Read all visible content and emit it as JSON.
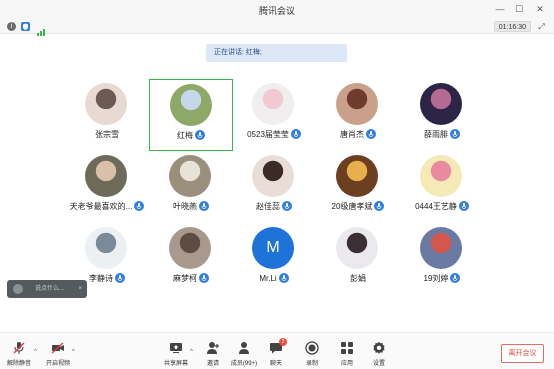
{
  "window": {
    "title": "腾讯会议",
    "controls": [
      "minimize-icon",
      "maximize-icon",
      "close-icon"
    ]
  },
  "status": {
    "timer": "01:16:30",
    "icons": [
      "info-icon",
      "shield-icon",
      "signal-icon"
    ]
  },
  "speaking": {
    "text": "正在讲话: 红梅;"
  },
  "participants": [
    {
      "name": "张宗雪",
      "mic": false,
      "avatar_color": "#e8d9d2",
      "avatar_accent": "#6e5a55"
    },
    {
      "name": "红梅",
      "mic": true,
      "avatar_color": "#8ea867",
      "avatar_accent": "#c7d7ea",
      "active": true
    },
    {
      "name": "0523届莹莹",
      "mic": true,
      "avatar_color": "#f1eef0",
      "avatar_accent": "#f0c9d2"
    },
    {
      "name": "唐肖杰",
      "mic": true,
      "avatar_color": "#caa08a",
      "avatar_accent": "#6e3b2c"
    },
    {
      "name": "薛雨腓",
      "mic": true,
      "avatar_color": "#2d2546",
      "avatar_accent": "#b56b8f"
    },
    {
      "name": "天老爷最喜欢的...",
      "mic": true,
      "avatar_color": "#6d6a5a",
      "avatar_accent": "#d9c1a8"
    },
    {
      "name": "叶晓燕",
      "mic": true,
      "avatar_color": "#9a8e7c",
      "avatar_accent": "#e9e2d6"
    },
    {
      "name": "赵佳蕊",
      "mic": true,
      "avatar_color": "#e8ddd7",
      "avatar_accent": "#3a2b25"
    },
    {
      "name": "20级唐孝斌",
      "mic": true,
      "avatar_color": "#6b3f1f",
      "avatar_accent": "#e7b04d"
    },
    {
      "name": "0444王艺静",
      "mic": true,
      "avatar_color": "#f5eab5",
      "avatar_accent": "#e98aa0"
    },
    {
      "name": "李静诗",
      "mic": true,
      "avatar_color": "#edf0f2",
      "avatar_accent": "#7a8a99"
    },
    {
      "name": "麻梦柯",
      "mic": true,
      "avatar_color": "#a9988c",
      "avatar_accent": "#5d4c44"
    },
    {
      "name": "Mr.Li",
      "mic": true,
      "avatar_color": "#1e73d9",
      "avatar_letter": "M"
    },
    {
      "name": "彭娟",
      "mic": false,
      "avatar_color": "#ece9ee",
      "avatar_accent": "#3a2f33"
    },
    {
      "name": "19刘婷",
      "mic": true,
      "avatar_color": "#6b7aa2",
      "avatar_accent": "#d4564c"
    }
  ],
  "toast": {
    "text": "说点什么...",
    "close": "×"
  },
  "toolbar": {
    "items": [
      {
        "label": "解除静音",
        "icon": "mic-muted-icon"
      },
      {
        "label": "开启视频",
        "icon": "video-off-icon"
      },
      {
        "label": "共享屏幕",
        "icon": "share-screen-icon"
      },
      {
        "label": "邀请",
        "icon": "invite-icon"
      },
      {
        "label": "成员(99+)",
        "icon": "members-icon"
      },
      {
        "label": "聊天",
        "icon": "chat-icon",
        "badge": "2"
      },
      {
        "label": "录制",
        "icon": "record-icon"
      },
      {
        "label": "应用",
        "icon": "apps-icon"
      },
      {
        "label": "设置",
        "icon": "settings-icon"
      }
    ],
    "leave": "离开会议"
  },
  "colors": {
    "accent_blue": "#2f7de1",
    "active_border": "#3ab54a",
    "leave_red": "#d94b3f",
    "banner": "#dde8f7"
  }
}
